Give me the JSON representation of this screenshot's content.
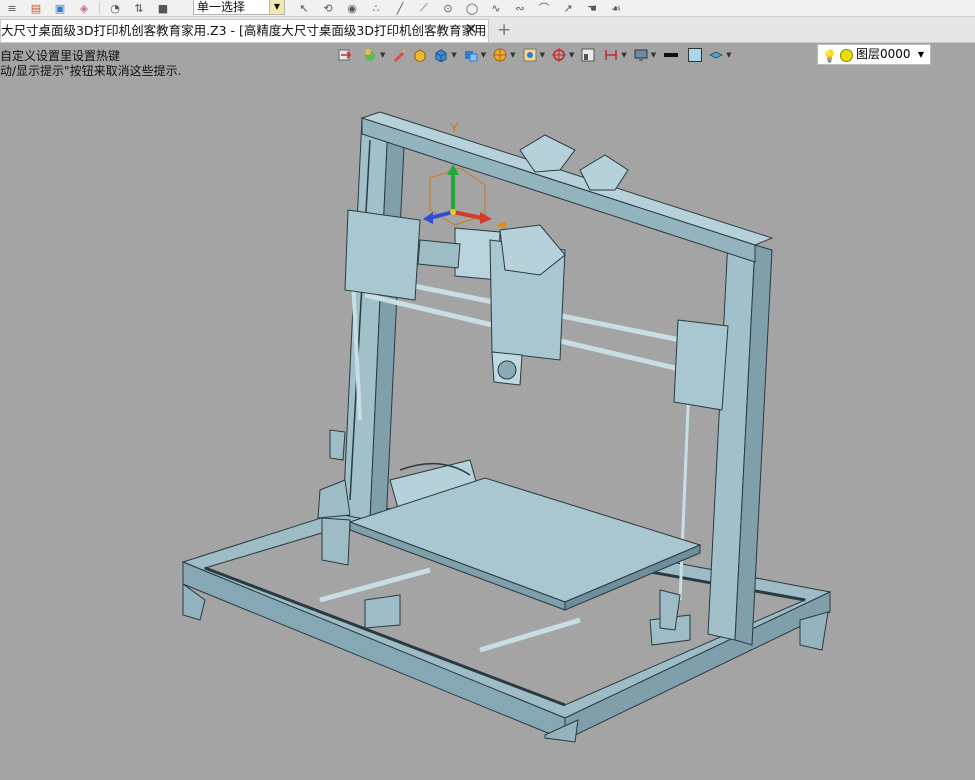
{
  "toolbar": {
    "selection_mode": "单一选择",
    "icons": [
      "layers-icon",
      "open-file-icon",
      "save-icon",
      "export-icon",
      "history-icon",
      "selection-filter-icon",
      "stop-icon"
    ],
    "sketch_icons": [
      "cursor-icon",
      "pick-icon",
      "play-icon",
      "point-icon",
      "line-icon",
      "circle-icon",
      "arc-icon",
      "spline-icon",
      "curve-icon",
      "trim-icon",
      "hand-icon",
      "rotate-icon"
    ]
  },
  "tabs": {
    "active_label": "大尺寸桌面级3D打印机创客教育家用.Z3 - [高精度大尺寸桌面级3D打印机创客教育家用]",
    "close_glyph": "✕",
    "add_glyph": "+"
  },
  "hints": {
    "line1": "自定义设置里设置热键",
    "line2": "动/显示提示\"按钮来取消这些提示."
  },
  "viewbar": {
    "icons": [
      "exit-view-icon",
      "render-icon",
      "brush-icon",
      "box-solid-icon",
      "cube-icon",
      "shading-icon",
      "appearance-icon",
      "view-orient-icon",
      "snap-icon",
      "section-icon",
      "measure-icon",
      "display-icon",
      "line-color-icon",
      "fill-color-icon",
      "layer-style-icon"
    ],
    "colors": {
      "accent": "#2c7bd6",
      "orange": "#e58a1a",
      "red": "#d23a2a",
      "green": "#3aa53a"
    }
  },
  "layer": {
    "name": "图层0000"
  },
  "viewport": {
    "background": "#a4a4a4",
    "model_color": "#a5c4cf",
    "axis_label_y": "Y",
    "axis_label_x": "X"
  }
}
